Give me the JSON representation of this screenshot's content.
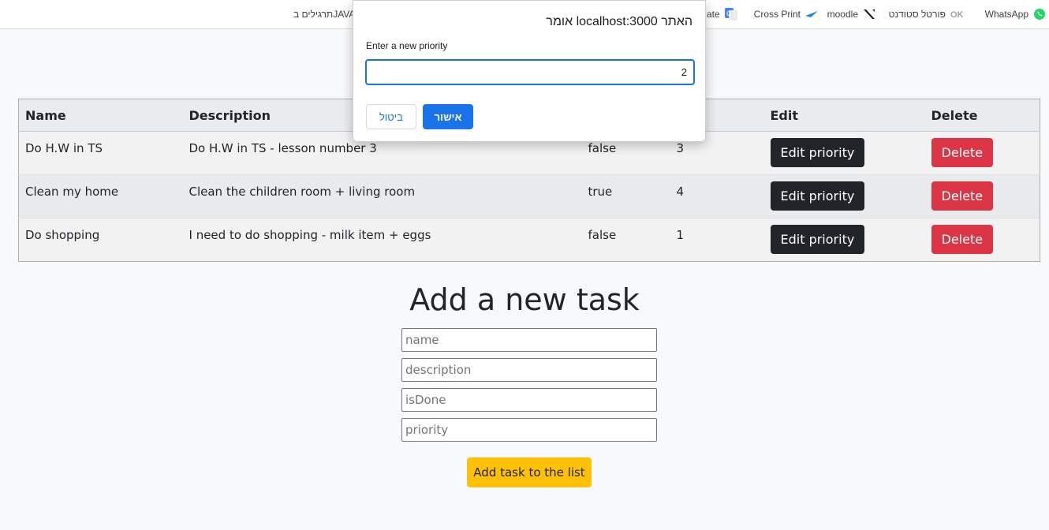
{
  "bookmarks": [
    {
      "label": "WhatsApp",
      "icon": "whatsapp-icon",
      "color": "#25d366"
    },
    {
      "label": "פורטל סטודנט",
      "icon": "ok-logo-icon",
      "color": "#9aa0a6"
    },
    {
      "label": "moodle",
      "icon": "slash-logo-icon",
      "color": "#202124"
    },
    {
      "label": "Cross Print",
      "icon": "plane-icon",
      "color": "#1e88e5"
    },
    {
      "label": "ate",
      "icon": "translate-icon",
      "color": "#4285f4"
    },
    {
      "label": "תרגילים בJAVA",
      "icon": "folder-icon",
      "color": "#5f6368"
    }
  ],
  "table": {
    "headers": [
      "Name",
      "Description",
      "",
      "ity",
      "Edit",
      "Delete"
    ],
    "rows": [
      {
        "name": "Do H.W in TS",
        "description": "Do H.W in TS - lesson number 3",
        "isDone": "false",
        "priority": "3",
        "edit": "Edit priority",
        "delete": "Delete"
      },
      {
        "name": "Clean my home",
        "description": "Clean the children room + living room",
        "isDone": "true",
        "priority": "4",
        "edit": "Edit priority",
        "delete": "Delete"
      },
      {
        "name": "Do shopping",
        "description": "I need to do shopping - milk item + eggs",
        "isDone": "false",
        "priority": "1",
        "edit": "Edit priority",
        "delete": "Delete"
      }
    ]
  },
  "add_form": {
    "title": "Add a new task",
    "name_placeholder": "name",
    "description_placeholder": "description",
    "isDone_placeholder": "isDone",
    "priority_placeholder": "priority",
    "submit_label": "Add task to the list"
  },
  "dialog": {
    "title": "האתר localhost:3000 אומר",
    "message": "Enter a new priority",
    "input_value": "2",
    "ok_label": "אישור",
    "cancel_label": "ביטול"
  },
  "colors": {
    "primary": "#1a73e8",
    "dark": "#212529",
    "danger": "#dc3545",
    "warning": "#ffc107"
  }
}
